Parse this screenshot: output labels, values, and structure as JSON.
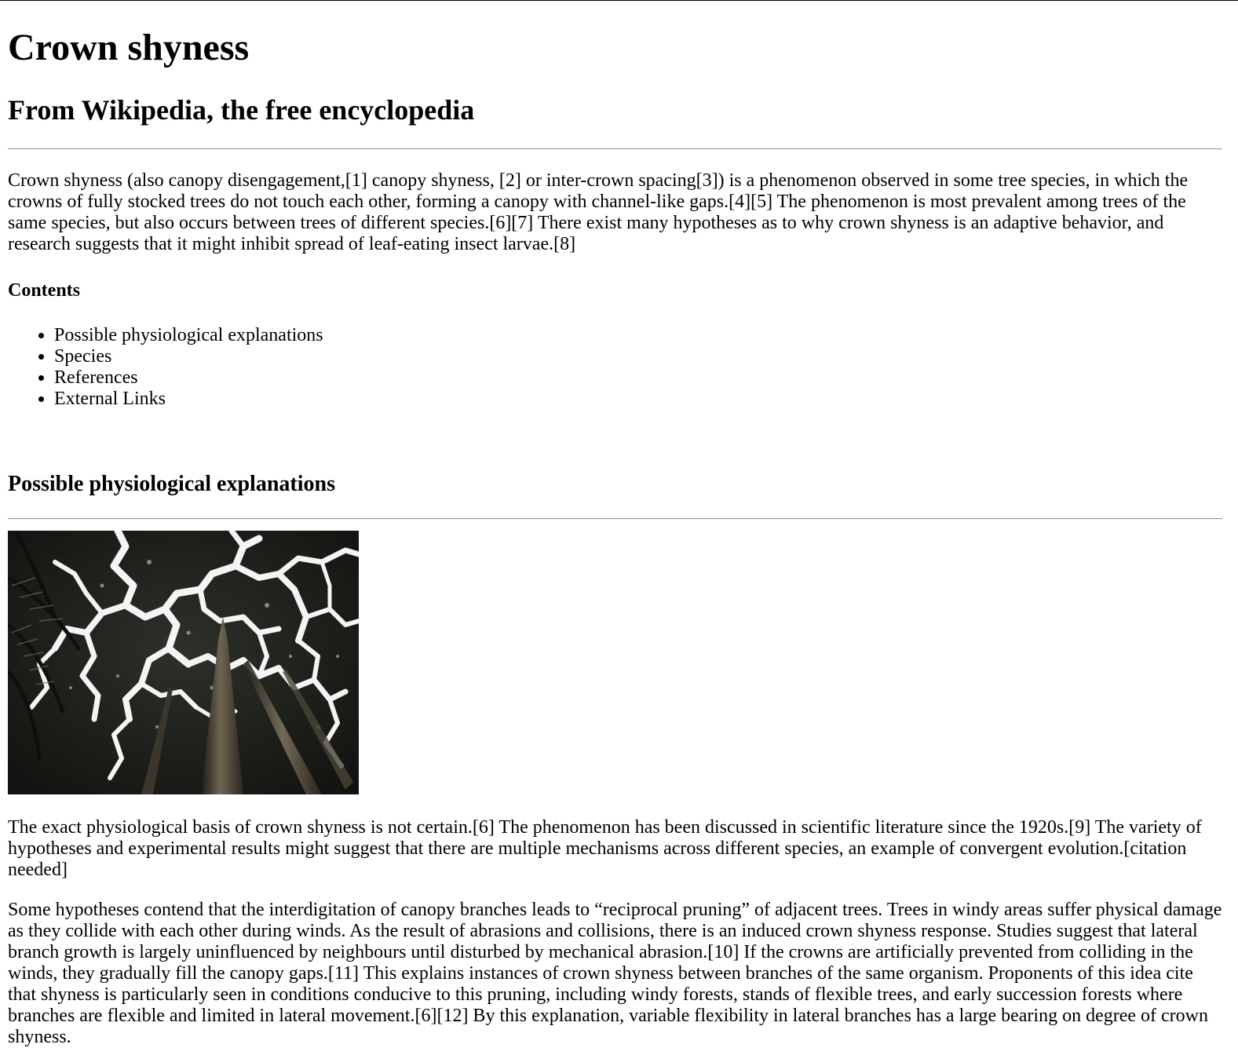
{
  "article": {
    "title": "Crown shyness",
    "subtitle": "From Wikipedia, the free encyclopedia",
    "intro": "Crown shyness (also canopy disengagement,[1] canopy shyness, [2] or inter-crown spacing[3]) is a phenomenon observed in some tree species, in which the crowns of fully stocked trees do not touch each other, forming a canopy with channel-like gaps.[4][5] The phenomenon is most prevalent among trees of the same species, but also occurs between trees of different species.[6][7] There exist many hypotheses as to why crown shyness is an adaptive behavior, and research suggests that it might inhibit spread of leaf-eating insect larvae.[8]"
  },
  "contents": {
    "heading": "Contents",
    "items": [
      {
        "label": "Possible physiological explanations"
      },
      {
        "label": "Species"
      },
      {
        "label": "References"
      },
      {
        "label": "External Links"
      }
    ]
  },
  "section_physiological": {
    "heading": "Possible physiological explanations",
    "paragraph_1": "The exact physiological basis of crown shyness is not certain.[6] The phenomenon has been discussed in scientific literature since the 1920s.[9] The variety of hypotheses and experimental results might suggest that there are multiple mechanisms across different species, an example of convergent evolution.[citation needed]",
    "paragraph_2": "Some hypotheses contend that the interdigitation of canopy branches leads to “reciprocal pruning” of adjacent trees. Trees in windy areas suffer physical damage as they collide with each other during winds. As the result of abrasions and collisions, there is an induced crown shyness response. Studies suggest that lateral branch growth is largely uninfluenced by neighbours until disturbed by mechanical abrasion.[10] If the crowns are artificially prevented from colliding in the winds, they gradually fill the canopy gaps.[11] This explains instances of crown shyness between branches of the same organism. Proponents of this idea cite that shyness is particularly seen in conditions conducive to this pruning, including windy forests, stands of flexible trees, and early succession forests where branches are flexible and limited in lateral movement.[6][12] By this explanation, variable flexibility in lateral branches has a large bearing on degree of crown shyness."
  },
  "colors": {
    "text": "#000000",
    "rule": "#9a9a9a",
    "canopy_dark": "#1c1d1a",
    "sky": "#ffffff"
  }
}
